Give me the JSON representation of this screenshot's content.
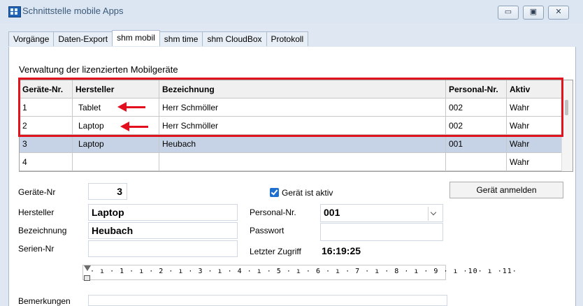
{
  "window": {
    "title": "Schnittstelle mobile Apps",
    "controls": {
      "minimize": "▭",
      "maximize": "▣",
      "close": "✕"
    }
  },
  "tabs": [
    {
      "label": "Vorgänge",
      "active": false
    },
    {
      "label": "Daten-Export",
      "active": false
    },
    {
      "label": "shm mobil",
      "active": true
    },
    {
      "label": "shm time",
      "active": false
    },
    {
      "label": "shm CloudBox",
      "active": false
    },
    {
      "label": "Protokoll",
      "active": false
    }
  ],
  "section_title": "Verwaltung der lizenzierten Mobilgeräte",
  "table": {
    "columns": [
      "Geräte-Nr.",
      "Hersteller",
      "Bezeichnung",
      "Personal-Nr.",
      "Aktiv"
    ],
    "rows": [
      [
        "1",
        "Tablet",
        "Herr Schmöller",
        "002",
        "Wahr"
      ],
      [
        "2",
        "Laptop",
        "Herr Schmöller",
        "002",
        "Wahr"
      ],
      [
        "3",
        "Laptop",
        "Heubach",
        "001",
        "Wahr"
      ],
      [
        "4",
        "",
        "",
        "",
        "Wahr"
      ]
    ]
  },
  "form": {
    "geraete_nr_label": "Geräte-Nr",
    "geraete_nr_value": "3",
    "hersteller_label": "Hersteller",
    "hersteller_value": "Laptop",
    "bezeichnung_label": "Bezeichnung",
    "bezeichnung_value": "Heubach",
    "serien_nr_label": "Serien-Nr",
    "serien_nr_value": "",
    "aktiv_label": "Gerät ist aktiv",
    "personal_nr_label": "Personal-Nr.",
    "personal_nr_value": "001",
    "passwort_label": "Passwort",
    "passwort_value": "",
    "letzter_zugriff_label": "Letzter Zugriff",
    "letzter_zugriff_value": "16:19:25",
    "anmelden_button": "Gerät anmelden",
    "bemerkungen_label": "Bemerkungen"
  },
  "ruler": {
    "scale": "· ı · 1 · ı · 2 · ı · 3 · ı · 4 · ı · 5 · ı · 6 · ı · 7 · ı · 8 · ı · 9 · ı ·10· ı ·11·"
  },
  "colors": {
    "highlight": "#e0141e",
    "selected_row": "#c6d3e6",
    "checkbox": "#1e6fce"
  }
}
